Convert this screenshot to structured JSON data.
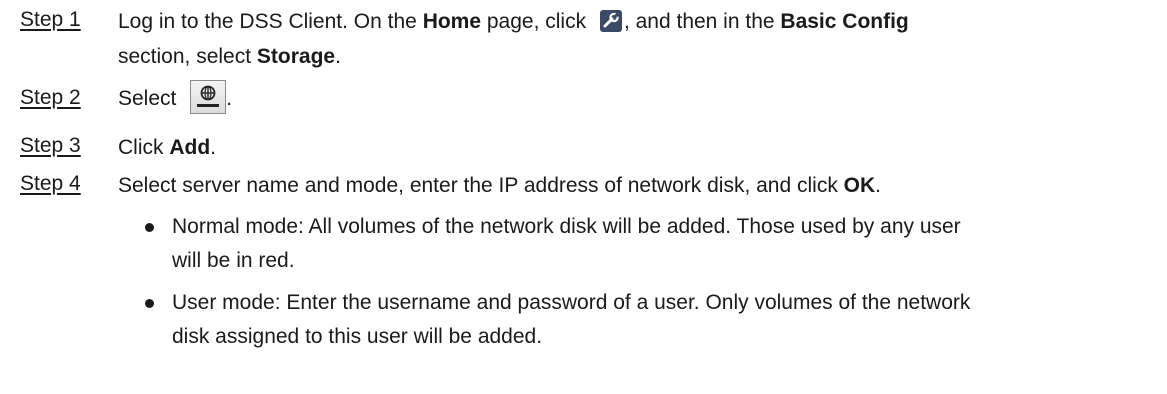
{
  "steps": [
    {
      "label": "Step 1",
      "parts": {
        "t1": "Log in to the DSS Client. On the ",
        "b1": "Home",
        "t2": " page, click ",
        "t3": ", and then in the ",
        "b2": "Basic Config",
        "t4": "section, select ",
        "b3": "Storage",
        "t5": "."
      },
      "icon": "wrench-icon"
    },
    {
      "label": "Step 2",
      "parts": {
        "t1": "Select ",
        "t2": "."
      },
      "icon": "network-disk-icon"
    },
    {
      "label": "Step 3",
      "parts": {
        "t1": "Click ",
        "b1": "Add",
        "t2": "."
      }
    },
    {
      "label": "Step 4",
      "parts": {
        "t1": "Select server name and mode, enter the IP address of network disk, and click ",
        "b1": "OK",
        "t2": "."
      }
    }
  ],
  "bullets": [
    {
      "line1": "Normal mode: All volumes of the network disk will be added. Those used by any user",
      "line2": "will be in red."
    },
    {
      "line1": "User mode: Enter the username and password of a user. Only volumes of the network",
      "line2": "disk assigned to this user will be added."
    }
  ],
  "colors": {
    "text": "#1a1a1a",
    "icon_background": "#3a4a66"
  }
}
